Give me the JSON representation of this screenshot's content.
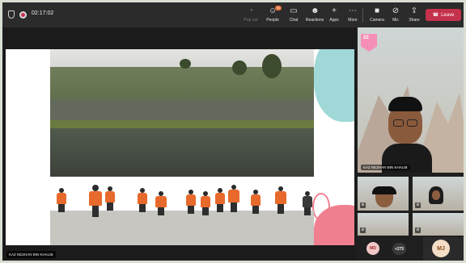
{
  "meeting": {
    "timer": "02:17:02"
  },
  "toolbar": {
    "items": [
      {
        "label": "Pop out",
        "icon": "pop-out-icon"
      },
      {
        "label": "People",
        "icon": "people-icon",
        "badge": "91"
      },
      {
        "label": "Chat",
        "icon": "chat-icon"
      },
      {
        "label": "Reactions",
        "icon": "reactions-icon"
      },
      {
        "label": "Apps",
        "icon": "apps-icon"
      },
      {
        "label": "More",
        "icon": "more-icon"
      },
      {
        "label": "Camera",
        "icon": "camera-icon"
      },
      {
        "label": "Mic",
        "icon": "mic-icon"
      },
      {
        "label": "Share",
        "icon": "share-icon"
      }
    ],
    "leave_label": "Leave"
  },
  "stage": {
    "presenter_name": "KAZ NEZHAN BIN KHALIB"
  },
  "participants": {
    "main": {
      "name": "KAZ NEZHAN BIN KHALIB",
      "flag_text": "22"
    },
    "avatars": [
      {
        "initials": "MD"
      },
      {
        "count": "+275"
      },
      {
        "initials": "MJ"
      }
    ]
  },
  "colors": {
    "leave": "#c4314b",
    "toolbar_bg": "#2b2b2b",
    "vest": "#e76a2c"
  }
}
